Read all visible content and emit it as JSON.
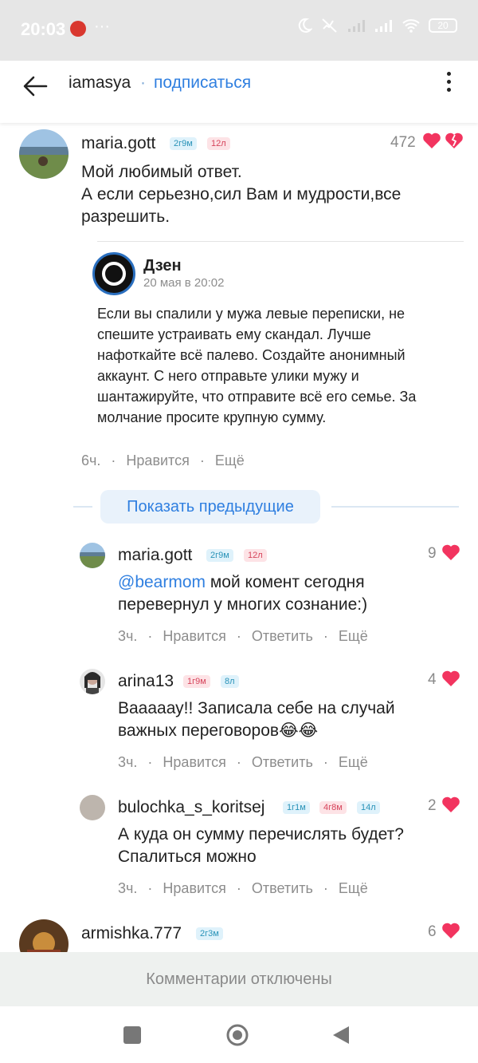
{
  "status": {
    "time": "20:03",
    "dots": "···",
    "battery": "20"
  },
  "header": {
    "username": "iamasya",
    "dot": "·",
    "subscribe": "подписаться"
  },
  "main_comment": {
    "author": "maria.gott",
    "badge1": "2г9м",
    "badge2": "12л",
    "likes": "472",
    "line1": "Мой любимый ответ.",
    "line2": "А если серьезно,сил  Вам и мудрости,все",
    "line3": "разрешить.",
    "time": "6ч.",
    "like_label": "Нравится",
    "more_label": "Ещё"
  },
  "quote": {
    "source": "Дзен",
    "date": "20 мая в 20:02",
    "lines": [
      "Если вы спалили у мужа левые переписки, не",
      "спешите устраивать ему скандал. Лучше",
      "нафоткайте всё палево. Создайте анонимный",
      "аккаунт. С него отправьте улики мужу и",
      "шантажируйте, что отправите всё его семье. За",
      "молчание просите крупную сумму."
    ]
  },
  "show_previous": "Показать предыдущие",
  "replies": [
    {
      "author": "maria.gott",
      "badges": [
        "2г9м",
        "12л"
      ],
      "likes": "9",
      "mention": "@bearmom",
      "line1": " мой комент сегодня",
      "line2": "перевернул у многих сознание:)",
      "time": "3ч.",
      "like_label": "Нравится",
      "reply_label": "Ответить",
      "more_label": "Ещё"
    },
    {
      "author": "arina13",
      "badges": [
        "1г9м",
        "8л"
      ],
      "likes": "4",
      "line1": "Вааааау!! Записала себе на случай",
      "line2": "важных переговоров😂😂",
      "time": "3ч.",
      "like_label": "Нравится",
      "reply_label": "Ответить",
      "more_label": "Ещё"
    },
    {
      "author": "bulochka_s_koritsej",
      "badges": [
        "1г1м",
        "4г8м",
        "14л"
      ],
      "likes": "2",
      "line1": "А куда он сумму перечислять будет?",
      "line2": "Спалиться можно",
      "time": "3ч.",
      "like_label": "Нравится",
      "reply_label": "Ответить",
      "more_label": "Ещё"
    }
  ],
  "next_comment": {
    "author": "armishka.777",
    "badge": "2г3м",
    "likes": "6"
  },
  "comments_disabled": "Комментарии отключены",
  "colors": {
    "accent": "#2f7fe0",
    "heart": "#f2345f",
    "muted": "#8d8d8d"
  },
  "icons": [
    "back-arrow-icon",
    "more-vertical-icon",
    "heart-icon",
    "moon-icon",
    "mute-icon",
    "signal-icon",
    "wifi-icon",
    "battery-icon",
    "square-nav-icon",
    "home-nav-icon",
    "back-nav-icon"
  ]
}
